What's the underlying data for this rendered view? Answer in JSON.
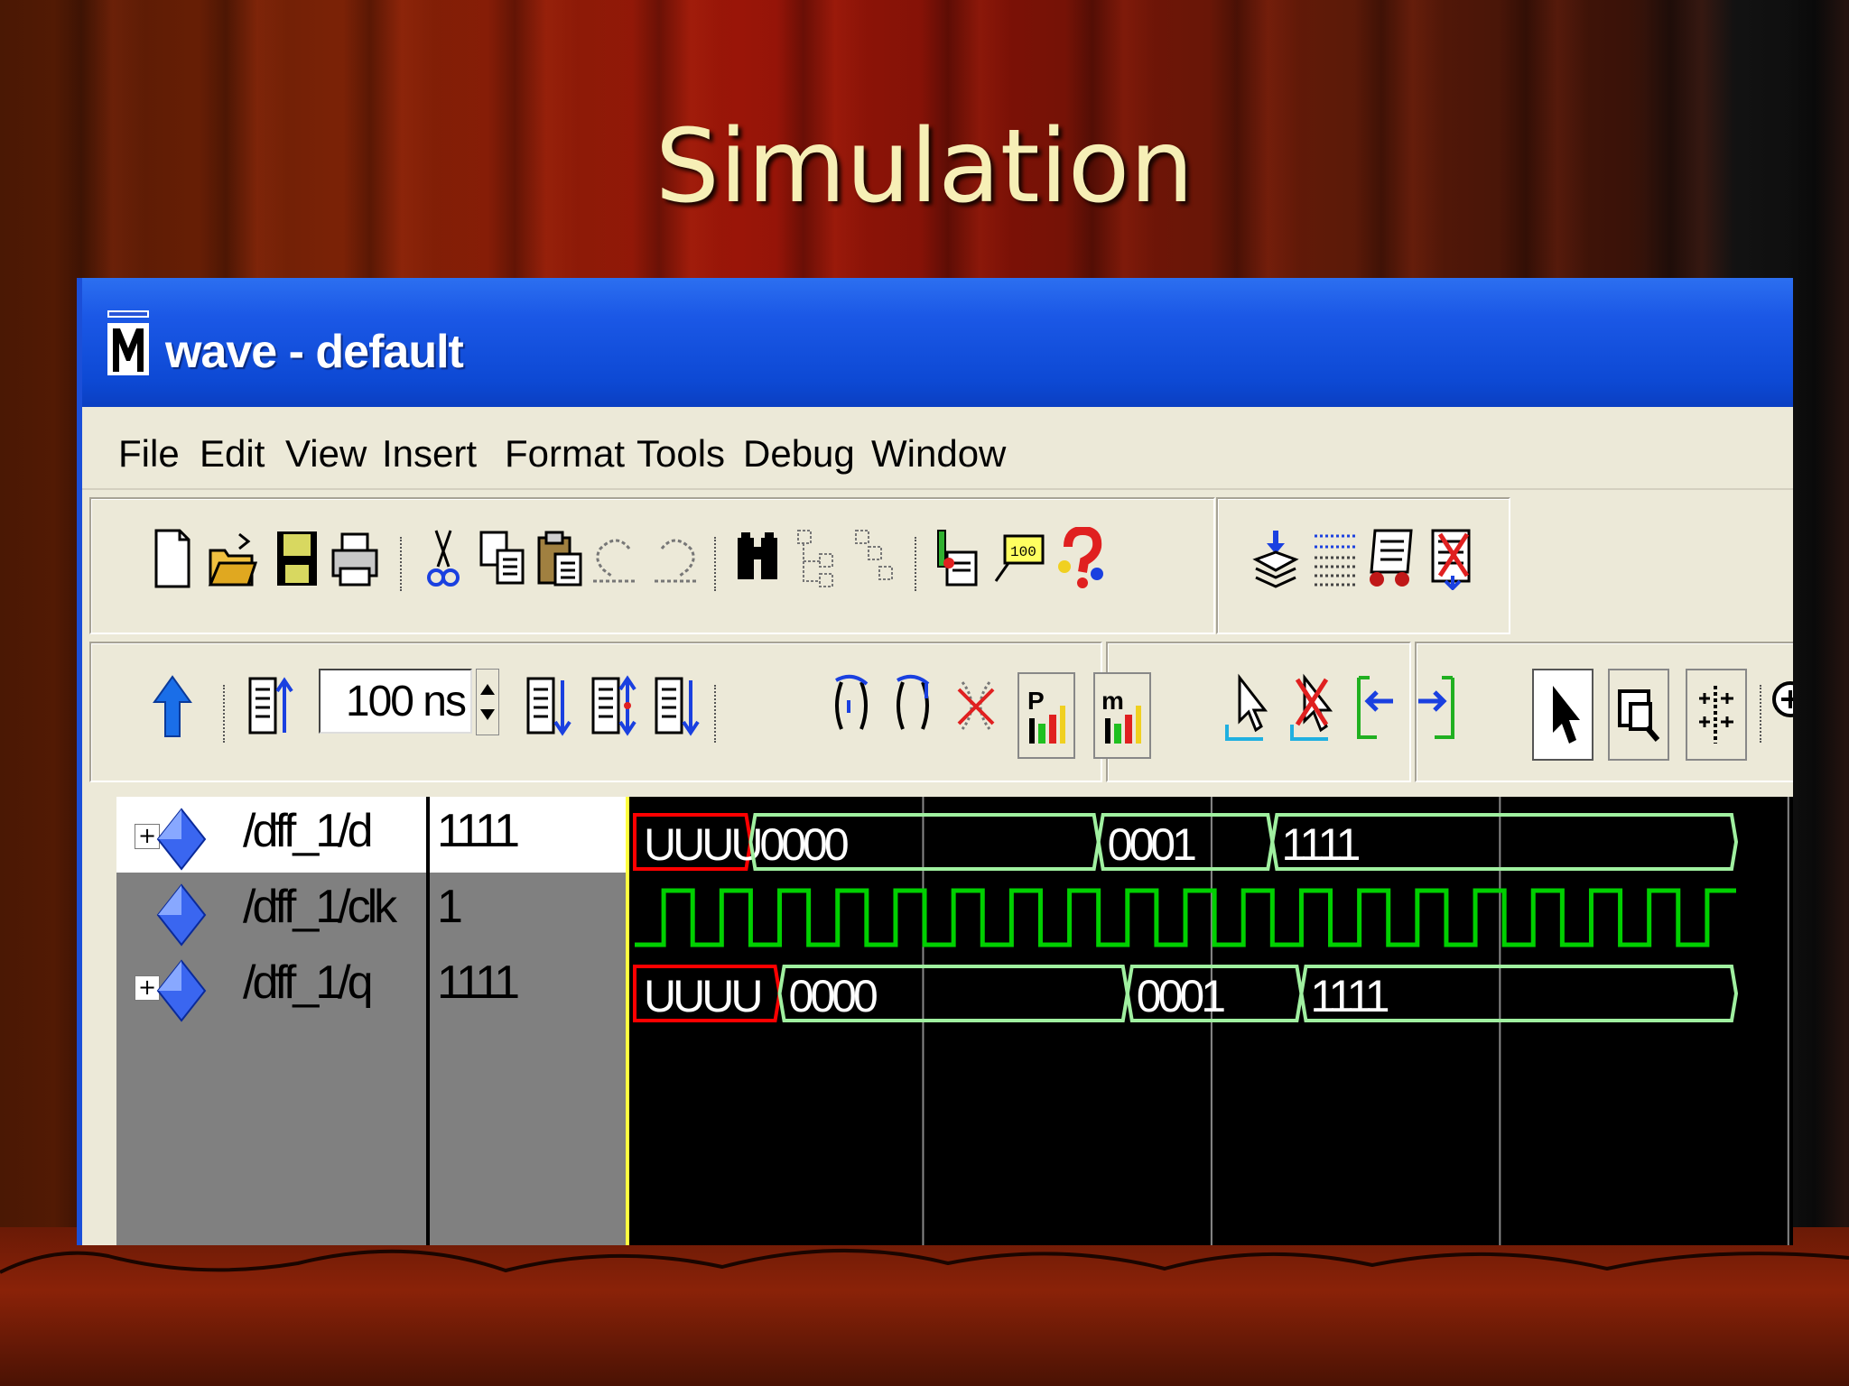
{
  "slide": {
    "title": "Simulation"
  },
  "window": {
    "title": "wave - default",
    "icon": "modelsim-m-icon"
  },
  "menu": [
    "File",
    "Edit",
    "View",
    "Insert",
    "Format",
    "Tools",
    "Debug",
    "Window"
  ],
  "toolbar": {
    "time_step_value": "100 ns",
    "row1_icons": [
      "new-file-icon",
      "open-folder-icon",
      "save-icon",
      "print-icon",
      "cut-icon",
      "copy-icon",
      "paste-icon",
      "undo-icon",
      "redo-icon",
      "find-icon",
      "collapse-icon",
      "expand-icon",
      "compile-icon",
      "tooltip-icon",
      "help-icon",
      "insert-divider-icon",
      "grid-icon",
      "macro-icon",
      "delete-icon"
    ],
    "row2_icons": [
      "restart-icon",
      "run-icon",
      "run-continue-icon",
      "run-all-icon",
      "step-icon",
      "step-over-icon",
      "break-icon",
      "continue-icon",
      "stop-icon",
      "performance-icon",
      "memory-icon",
      "insert-cursor-icon",
      "delete-cursor-icon",
      "previous-edge-icon",
      "next-edge-icon",
      "select-mode-icon",
      "zoom-mode-icon",
      "insert-marker-icon",
      "zoom-in-icon"
    ]
  },
  "signals": [
    {
      "name": "/dff_1/d",
      "value": "1111",
      "expandable": true,
      "segments": [
        {
          "label": "UUUU",
          "start": 0,
          "end": 400,
          "color": "#ff0000"
        },
        {
          "label": "0000",
          "start": 400,
          "end": 1600,
          "color": "#a0f0a0"
        },
        {
          "label": "0001",
          "start": 1600,
          "end": 2200,
          "color": "#a0f0a0"
        },
        {
          "label": "1111",
          "start": 2200,
          "end": 3800,
          "color": "#a0f0a0"
        }
      ]
    },
    {
      "name": "/dff_1/clk",
      "value": "1",
      "expandable": false,
      "clock_period": 200
    },
    {
      "name": "/dff_1/q",
      "value": "1111",
      "expandable": true,
      "segments": [
        {
          "label": "UUUU",
          "start": 0,
          "end": 500,
          "color": "#ff0000"
        },
        {
          "label": "0000",
          "start": 500,
          "end": 1700,
          "color": "#a0f0a0"
        },
        {
          "label": "0001",
          "start": 1700,
          "end": 2300,
          "color": "#a0f0a0"
        },
        {
          "label": "1111",
          "start": 2300,
          "end": 3800,
          "color": "#a0f0a0"
        }
      ]
    }
  ],
  "colors": {
    "clock": "#00d000",
    "bus": "#a0f0a0",
    "undefined": "#ff0000",
    "grid": "#888888",
    "cursor": "#ffff40"
  }
}
